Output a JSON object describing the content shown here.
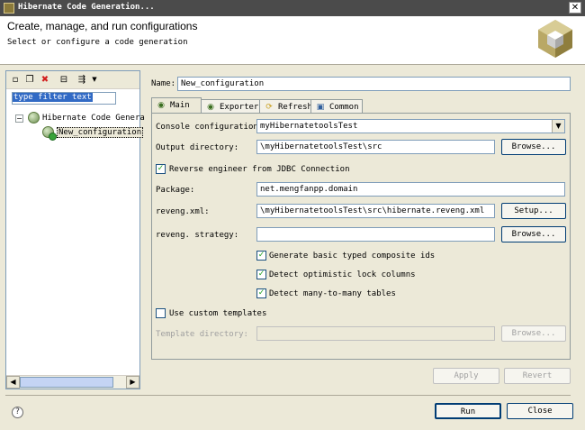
{
  "window": {
    "title": "Hibernate Code Generation..."
  },
  "banner": {
    "title": "Create, manage, and run configurations",
    "subtitle": "Select or configure a code generation"
  },
  "sidebar": {
    "filter_text": "type filter text",
    "tree": {
      "root": "Hibernate Code Genera",
      "child": "New_configuration"
    }
  },
  "name_label": "Name:",
  "name_value": "New_configuration",
  "tabs": [
    "Main",
    "Exporters",
    "Refresh",
    "Common"
  ],
  "form": {
    "console_label": "Console configuration:",
    "console_value": "myHibernatetoolsTest",
    "output_label": "Output directory:",
    "output_value": "\\myHibernatetoolsTest\\src",
    "reverse_label": "Reverse engineer from JDBC Connection",
    "package_label": "Package:",
    "package_value": "net.mengfanpp.domain",
    "reveng_xml_label": "reveng.xml:",
    "reveng_xml_value": "\\myHibernatetoolsTest\\src\\hibernate.reveng.xml",
    "reveng_strategy_label": "reveng. strategy:",
    "reveng_strategy_value": "",
    "composite_label": "Generate basic typed composite ids",
    "optimistic_label": "Detect optimistic lock columns",
    "many_label": "Detect many-to-many tables",
    "templates_label": "Use custom templates",
    "template_dir_label": "Template directory:",
    "template_dir_value": "",
    "browse": "Browse...",
    "setup": "Setup..."
  },
  "buttons": {
    "apply": "Apply",
    "revert": "Revert",
    "run": "Run",
    "close": "Close"
  }
}
